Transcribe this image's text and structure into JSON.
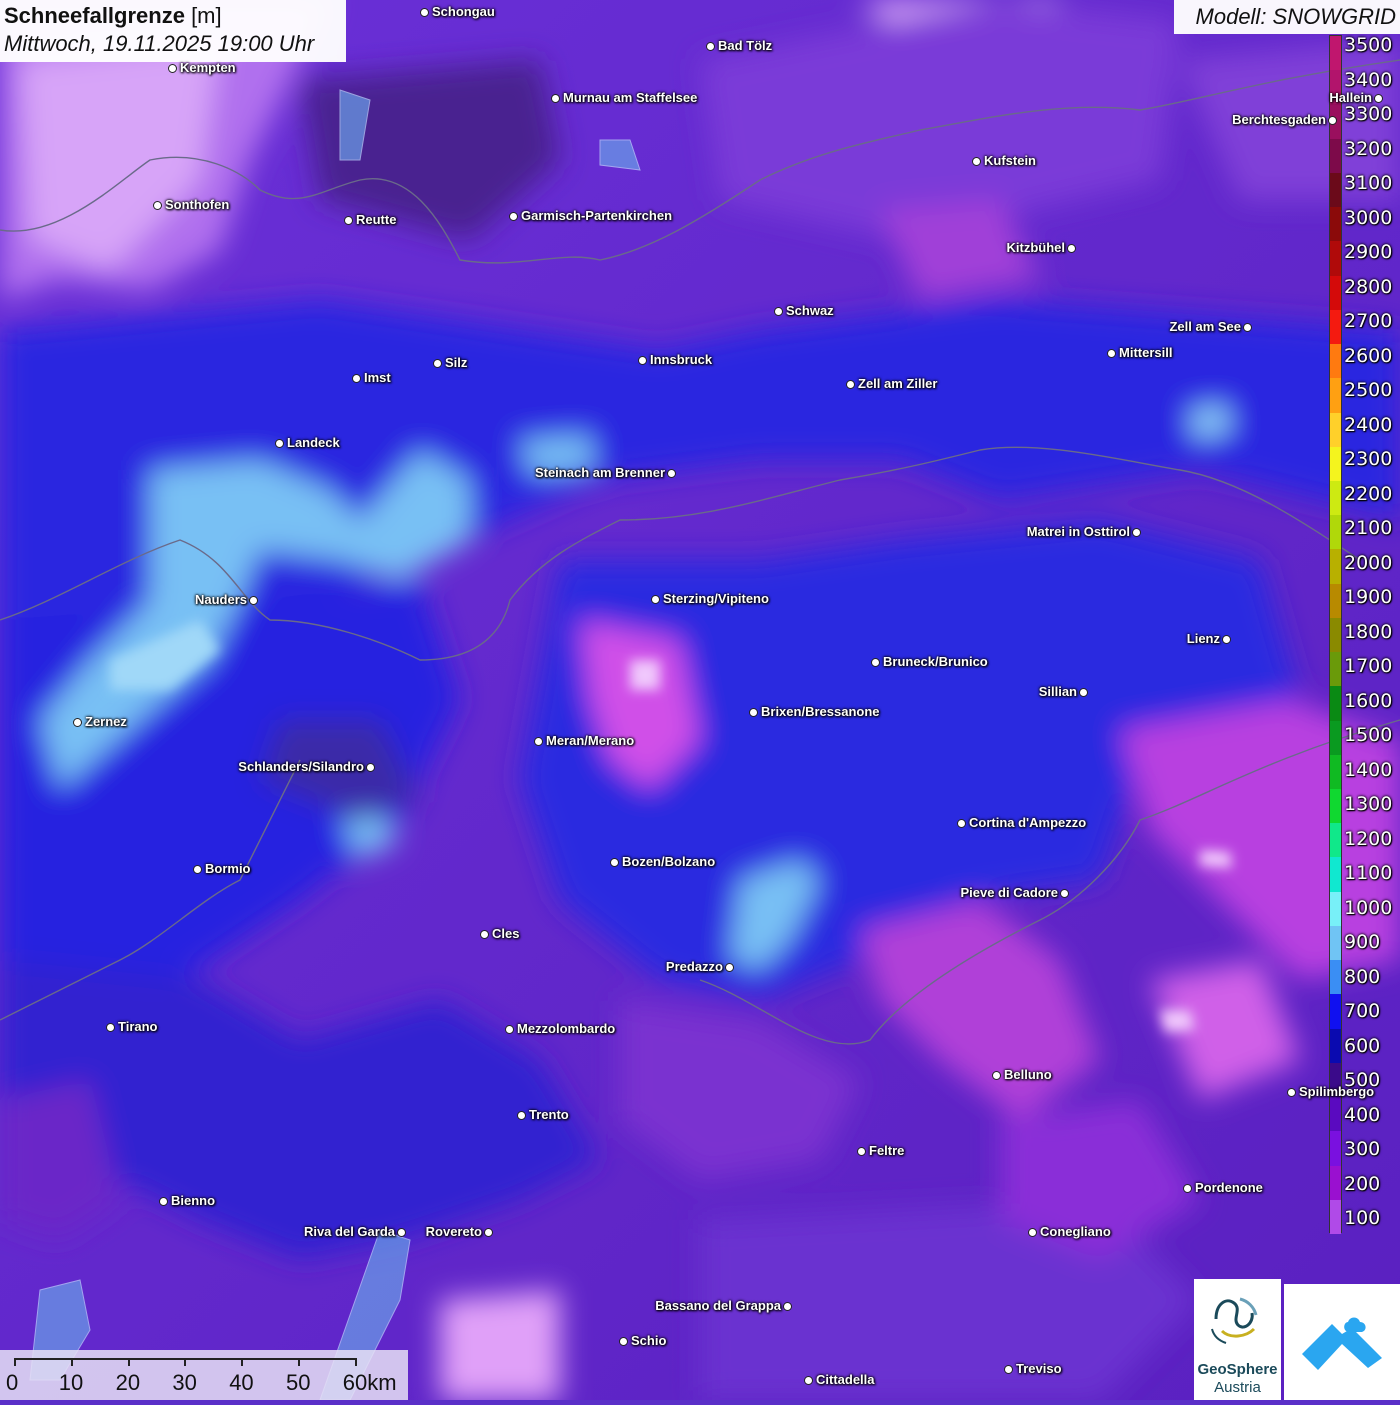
{
  "header": {
    "title_bold": "Schneefallgrenze",
    "title_unit": " [m]",
    "datetime": "Mittwoch, 19.11.2025 19:00 Uhr",
    "model": "Modell: SNOWGRID"
  },
  "legend": {
    "labels": [
      "3500",
      "3400",
      "3300",
      "3200",
      "3100",
      "3000",
      "2900",
      "2800",
      "2700",
      "2600",
      "2500",
      "2400",
      "2300",
      "2200",
      "2100",
      "2000",
      "1900",
      "1800",
      "1700",
      "1600",
      "1500",
      "1400",
      "1300",
      "1200",
      "1100",
      "1000",
      "900",
      "800",
      "700",
      "600",
      "500",
      "400",
      "300",
      "200",
      "100"
    ],
    "colors": [
      "#c0166e",
      "#b2146c",
      "#9a0f5e",
      "#7d0a4a",
      "#6b0a1a",
      "#8b0a0a",
      "#b00a0a",
      "#d40a0a",
      "#f41a10",
      "#ff7a10",
      "#ffa012",
      "#ffd02a",
      "#f4f41e",
      "#cdea12",
      "#b0d80a",
      "#b8b000",
      "#b88a00",
      "#8a8a00",
      "#6a9a0a",
      "#0a8a14",
      "#0a9a20",
      "#10ba22",
      "#10d830",
      "#10e88a",
      "#10e8d0",
      "#78f0f8",
      "#70c4f4",
      "#3a8ef4",
      "#1010f0",
      "#0a0ab0",
      "#3a0a8a",
      "#5a0ac0",
      "#7a10e0",
      "#9a10d0",
      "#b04ae8"
    ]
  },
  "cities": [
    {
      "name": "Schongau"
    },
    {
      "name": "Bad Tölz"
    },
    {
      "name": "Kempten"
    },
    {
      "name": "Murnau am Staffelsee"
    },
    {
      "name": "Berchtesgaden"
    },
    {
      "name": "Kufstein"
    },
    {
      "name": "Sonthofen"
    },
    {
      "name": "Reutte"
    },
    {
      "name": "Garmisch-Partenkirchen"
    },
    {
      "name": "Kitzbühel"
    },
    {
      "name": "Schwaz"
    },
    {
      "name": "Zell am See"
    },
    {
      "name": "Innsbruck"
    },
    {
      "name": "Mittersill"
    },
    {
      "name": "Silz"
    },
    {
      "name": "Imst"
    },
    {
      "name": "Zell am Ziller"
    },
    {
      "name": "Landeck"
    },
    {
      "name": "Steinach am Brenner"
    },
    {
      "name": "Matrei in Osttirol"
    },
    {
      "name": "Nauders"
    },
    {
      "name": "Sterzing/Vipiteno"
    },
    {
      "name": "Lienz"
    },
    {
      "name": "Bruneck/Brunico"
    },
    {
      "name": "Sillian"
    },
    {
      "name": "Zernez"
    },
    {
      "name": "Brixen/Bressanone"
    },
    {
      "name": "Meran/Merano"
    },
    {
      "name": "Schlanders/Silandro"
    },
    {
      "name": "Cortina d'Ampezzo"
    },
    {
      "name": "Bozen/Bolzano"
    },
    {
      "name": "Bormio"
    },
    {
      "name": "Pieve di Cadore"
    },
    {
      "name": "Cles"
    },
    {
      "name": "Predazzo"
    },
    {
      "name": "Tirano"
    },
    {
      "name": "Mezzolombardo"
    },
    {
      "name": "Belluno"
    },
    {
      "name": "Spilimbergo"
    },
    {
      "name": "Trento"
    },
    {
      "name": "Feltre"
    },
    {
      "name": "Pordenone"
    },
    {
      "name": "Bienno"
    },
    {
      "name": "Riva del Garda"
    },
    {
      "name": "Rovereto"
    },
    {
      "name": "Conegliano"
    },
    {
      "name": "Bassano del Grappa"
    },
    {
      "name": "Schio"
    },
    {
      "name": "Treviso"
    },
    {
      "name": "Cittadella"
    },
    {
      "name": "Hallein"
    }
  ],
  "scale": {
    "labels": [
      "0",
      "10",
      "20",
      "30",
      "40",
      "50",
      "60km"
    ]
  },
  "logos": {
    "geosphere_line1": "GeoSphere",
    "geosphere_line2": "Austria"
  }
}
